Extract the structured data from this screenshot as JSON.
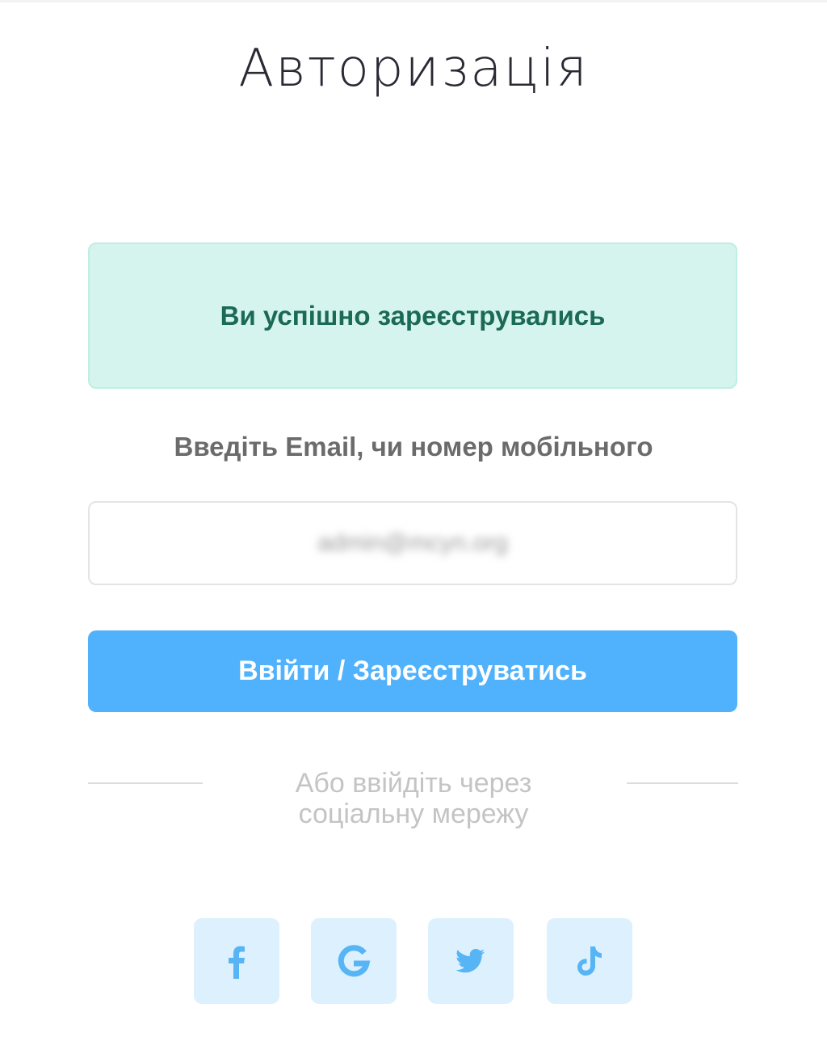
{
  "page": {
    "title": "Авторизація"
  },
  "alert": {
    "message": "Ви успішно зареєструвались"
  },
  "login_form": {
    "label": "Введіть Email, чи номер мобільного",
    "email_value": "admin@mcyn.org",
    "submit_label": "Ввійти / Зареєструватись"
  },
  "social": {
    "divider_text": "Або ввійдіть через соціальну мережу",
    "buttons": [
      {
        "icon": "facebook-icon"
      },
      {
        "icon": "google-icon"
      },
      {
        "icon": "twitter-icon"
      },
      {
        "icon": "tiktok-icon"
      }
    ]
  },
  "colors": {
    "primary": "#50b2fc",
    "success_bg": "#d5f4ee",
    "success_text": "#1b6a55",
    "social_bg": "#dcf0fe",
    "social_icon": "#57b5f5"
  }
}
